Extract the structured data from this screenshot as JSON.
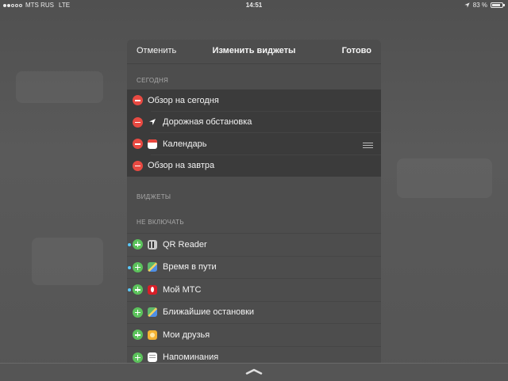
{
  "status_bar": {
    "signal_dots_full": 2,
    "signal_dots_total": 5,
    "carrier": "MTS RUS",
    "network": "LTE",
    "time": "14:51",
    "battery_text": "83 %",
    "battery_level": 0.83,
    "location_icon": "location-arrow-icon"
  },
  "navbar": {
    "cancel": "Отменить",
    "title": "Изменить виджеты",
    "done": "Готово"
  },
  "sections": {
    "today": "СЕГОДНЯ",
    "widgets": "ВИДЖЕТЫ",
    "do_not_include": "НЕ ВКЛЮЧАТЬ"
  },
  "included": [
    {
      "label": "Обзор на сегодня",
      "icon": "none",
      "reorder": false
    },
    {
      "label": "Дорожная обстановка",
      "icon": "location-arrow-icon",
      "reorder": false
    },
    {
      "label": "Календарь",
      "icon": "calendar-icon",
      "reorder": true
    },
    {
      "label": "Обзор на завтра",
      "icon": "none",
      "reorder": false
    }
  ],
  "excluded": [
    {
      "label": "QR Reader",
      "icon": "qr-reader-icon",
      "new": true
    },
    {
      "label": "Время в пути",
      "icon": "maps-icon",
      "new": true
    },
    {
      "label": "Мой МТС",
      "icon": "mts-icon",
      "new": true
    },
    {
      "label": "Ближайшие остановки",
      "icon": "maps-icon",
      "new": false
    },
    {
      "label": "Мои друзья",
      "icon": "friends-icon",
      "new": false
    },
    {
      "label": "Напоминания",
      "icon": "reminders-icon",
      "new": false
    }
  ],
  "colors": {
    "remove": "#e84a42",
    "add": "#5cc35c",
    "new_dot": "#5ac8fa"
  }
}
